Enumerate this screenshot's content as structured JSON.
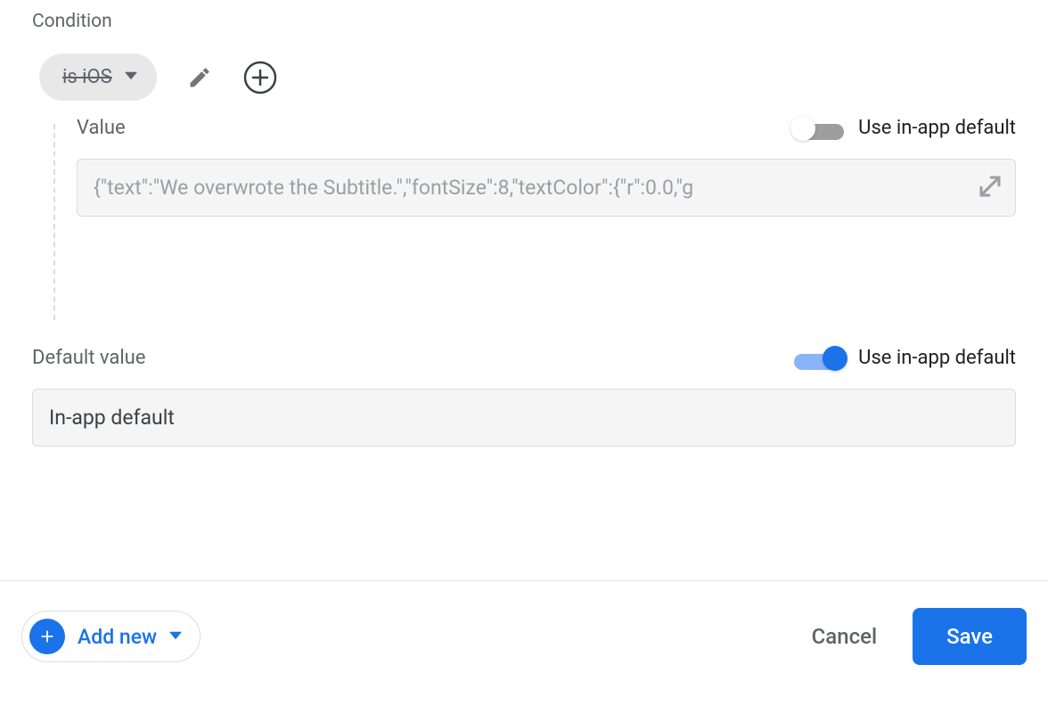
{
  "condition": {
    "section_label": "Condition",
    "chip_label": "is iOS",
    "value": {
      "label": "Value",
      "toggle_label": "Use in-app default",
      "toggle_on": false,
      "input_value": "{\"text\":\"We overwrote the Subtitle.\",\"fontSize\":8,\"textColor\":{\"r\":0.0,\"g"
    }
  },
  "default": {
    "label": "Default value",
    "toggle_label": "Use in-app default",
    "toggle_on": true,
    "input_value": "In-app default"
  },
  "footer": {
    "add_new_label": "Add new",
    "cancel_label": "Cancel",
    "save_label": "Save"
  }
}
